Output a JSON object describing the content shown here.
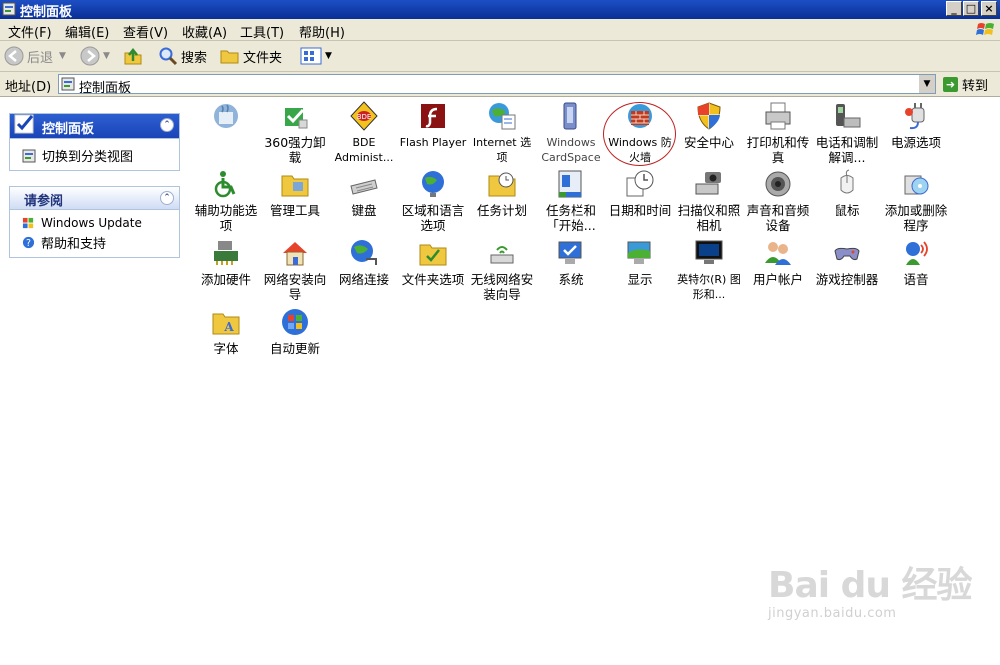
{
  "window": {
    "title": "控制面板"
  },
  "menubar": {
    "items": [
      "文件(F)",
      "编辑(E)",
      "查看(V)",
      "收藏(A)",
      "工具(T)",
      "帮助(H)"
    ]
  },
  "toolbar": {
    "back": "后退",
    "search": "搜索",
    "folders": "文件夹"
  },
  "address": {
    "label": "地址(D)",
    "value": "控制面板",
    "go": "转到"
  },
  "side": {
    "panel1": {
      "title": "控制面板",
      "link": "切换到分类视图"
    },
    "panel2": {
      "title": "请参阅",
      "links": [
        "Windows Update",
        "帮助和支持"
      ]
    }
  },
  "items": [
    {
      "label": ""
    },
    {
      "label": "360强力卸载"
    },
    {
      "label": "BDE Administ..."
    },
    {
      "label": "Flash Player"
    },
    {
      "label": "Internet 选项"
    },
    {
      "label": "Windows CardSpace"
    },
    {
      "label": "Windows 防火墙"
    },
    {
      "label": "安全中心"
    },
    {
      "label": "打印机和传真"
    },
    {
      "label": "电话和调制解调..."
    },
    {
      "label": "电源选项"
    },
    {
      "label": "辅助功能选项"
    },
    {
      "label": "管理工具"
    },
    {
      "label": "键盘"
    },
    {
      "label": "区域和语言选项"
    },
    {
      "label": "任务计划"
    },
    {
      "label": "任务栏和「开始..."
    },
    {
      "label": "日期和时间"
    },
    {
      "label": "扫描仪和照相机"
    },
    {
      "label": "声音和音频设备"
    },
    {
      "label": "鼠标"
    },
    {
      "label": "添加或删除程序"
    },
    {
      "label": "添加硬件"
    },
    {
      "label": "网络安装向导"
    },
    {
      "label": "网络连接"
    },
    {
      "label": "文件夹选项"
    },
    {
      "label": "无线网络安装向导"
    },
    {
      "label": "系统"
    },
    {
      "label": "显示"
    },
    {
      "label": "英特尔(R) 图形和..."
    },
    {
      "label": "用户帐户"
    },
    {
      "label": "游戏控制器"
    },
    {
      "label": "语音"
    },
    {
      "label": "字体"
    },
    {
      "label": "自动更新"
    }
  ],
  "watermark": {
    "brand": "Bai du 经验",
    "url": "jingyan.baidu.com"
  }
}
